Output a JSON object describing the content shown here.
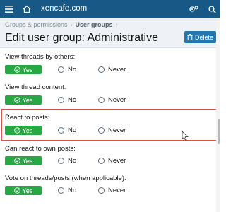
{
  "topbar": {
    "site_name": "xencafe.com",
    "background": "#185886"
  },
  "breadcrumb": {
    "item1": "Groups & permissions",
    "item2": "User groups"
  },
  "page": {
    "title": "Edit user group: Administrative",
    "delete_label": "Delete"
  },
  "permissions": [
    {
      "label": "View threads by others:",
      "selected": "Yes",
      "options": [
        "Yes",
        "No",
        "Never"
      ]
    },
    {
      "label": "View thread content:",
      "selected": "Yes",
      "options": [
        "Yes",
        "No",
        "Never"
      ]
    },
    {
      "label": "React to posts:",
      "selected": "Yes",
      "options": [
        "Yes",
        "No",
        "Never"
      ]
    },
    {
      "label": "Can react to own posts:",
      "selected": "Yes",
      "options": [
        "Yes",
        "No",
        "Never"
      ]
    },
    {
      "label": "Vote on threads/posts (when applicable):",
      "selected": "Yes",
      "options": [
        "Yes",
        "No",
        "Never"
      ]
    }
  ],
  "colors": {
    "yes_green": "#28a745",
    "accent_blue": "#2577b1",
    "highlight_red": "#d9534f"
  }
}
